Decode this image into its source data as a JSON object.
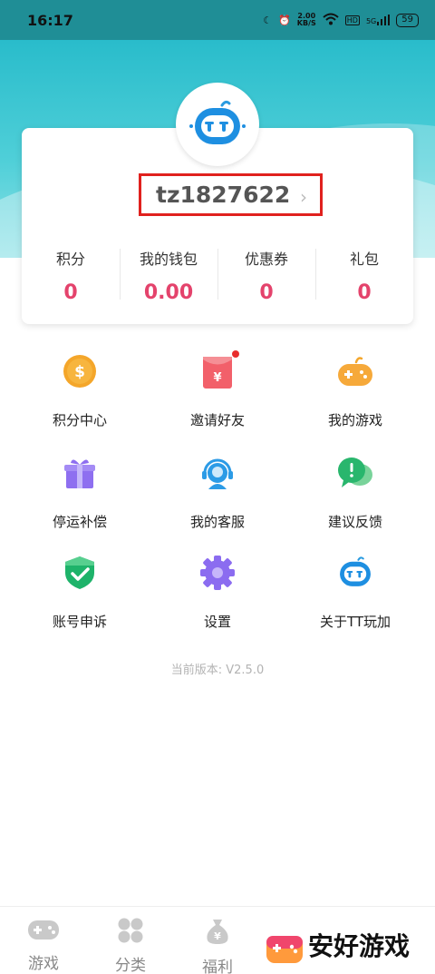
{
  "status_bar": {
    "time": "16:17",
    "speed_value": "2.00",
    "speed_unit": "KB/S",
    "hd": "HD",
    "network": "5G",
    "battery": "59"
  },
  "profile": {
    "username": "tz1827622"
  },
  "stats": [
    {
      "label": "积分",
      "value": "0"
    },
    {
      "label": "我的钱包",
      "value": "0.00"
    },
    {
      "label": "优惠券",
      "value": "0"
    },
    {
      "label": "礼包",
      "value": "0"
    }
  ],
  "menu": [
    {
      "label": "积分中心",
      "icon": "coin-icon"
    },
    {
      "label": "邀请好友",
      "icon": "red-envelope-icon"
    },
    {
      "label": "我的游戏",
      "icon": "gamepad-icon"
    },
    {
      "label": "停运补偿",
      "icon": "gift-icon"
    },
    {
      "label": "我的客服",
      "icon": "customer-service-icon"
    },
    {
      "label": "建议反馈",
      "icon": "chat-icon"
    },
    {
      "label": "账号申诉",
      "icon": "shield-check-icon"
    },
    {
      "label": "设置",
      "icon": "gear-icon"
    },
    {
      "label": "关于TT玩加",
      "icon": "robot-logo-icon"
    }
  ],
  "version": "当前版本: V2.5.0",
  "tabs": [
    {
      "label": "游戏",
      "icon": "gamepad-icon"
    },
    {
      "label": "分类",
      "icon": "category-icon"
    },
    {
      "label": "福利",
      "icon": "money-bag-icon"
    }
  ],
  "watermark": {
    "text": "安好游戏"
  },
  "colors": {
    "accent": "#e4436c",
    "hero": "#29bccb",
    "highlight_box": "#e0211e"
  }
}
